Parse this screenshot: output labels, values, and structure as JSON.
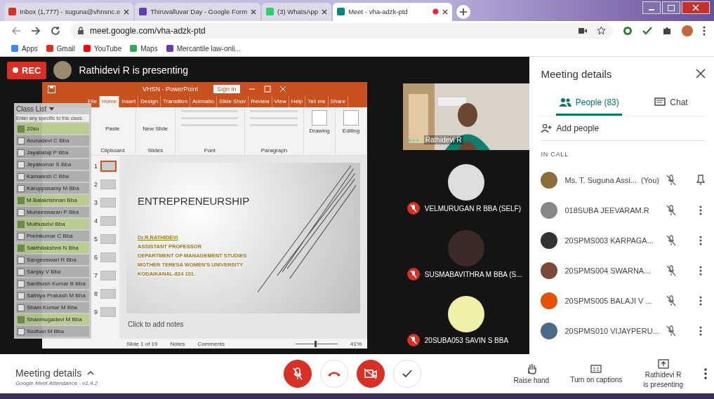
{
  "browser": {
    "tabs": [
      {
        "title": "Inbox (1,777) - suguna@vhnsnc.e",
        "kind": "mail",
        "selected": false
      },
      {
        "title": "Thiruvalluvar Day - Google Form",
        "kind": "form",
        "selected": false
      },
      {
        "title": "(3) WhatsApp",
        "kind": "chat",
        "selected": false
      },
      {
        "title": "Meet - vha-adzk-ptd",
        "kind": "video",
        "selected": true,
        "recording": true
      }
    ],
    "url": "meet.google.com/vha-adzk-ptd",
    "bookmarks": [
      {
        "label": "Apps",
        "kind": "grid"
      },
      {
        "label": "Gmail",
        "kind": "mail"
      },
      {
        "label": "YouTube",
        "kind": "play"
      },
      {
        "label": "Maps",
        "kind": "pin"
      },
      {
        "label": "Mercantile law-onli...",
        "kind": "form"
      }
    ]
  },
  "stage": {
    "rec": "REC",
    "banner": "Rathidevi R is presenting"
  },
  "powerpoint": {
    "title": "VHSN - PowerPoint",
    "sign_in": "Sign in",
    "tabs": [
      {
        "label": "File",
        "selected": false
      },
      {
        "label": "Home",
        "selected": true
      },
      {
        "label": "Insert",
        "selected": false
      },
      {
        "label": "Design",
        "selected": false
      },
      {
        "label": "Transition",
        "selected": false
      },
      {
        "label": "Animatio",
        "selected": false
      },
      {
        "label": "Slide Shov",
        "selected": false
      },
      {
        "label": "Review",
        "selected": false
      },
      {
        "label": "View",
        "selected": false
      },
      {
        "label": "Help",
        "selected": false
      }
    ],
    "tell_me": "Tell me",
    "share": "Share",
    "paste": "Paste",
    "new_slide": "New Slide",
    "drawing": "Drawing",
    "editing": "Editing",
    "groups": [
      "Clipboard",
      "Slides",
      "Font",
      "Paragraph"
    ],
    "thumbnails": [
      {
        "number": "1",
        "selected": true
      },
      {
        "number": "2",
        "selected": false
      },
      {
        "number": "3",
        "selected": false
      },
      {
        "number": "4",
        "selected": false
      },
      {
        "number": "5",
        "selected": false
      },
      {
        "number": "6",
        "selected": false
      },
      {
        "number": "7",
        "selected": false
      },
      {
        "number": "8",
        "selected": false
      },
      {
        "number": "9",
        "selected": false
      }
    ],
    "slide_title": "ENTREPRENEURSHIP",
    "slide_lines": [
      "Dr.R.RATHIDEVI",
      "ASSISTANT PROFESSOR",
      "DEPARTMENT OF MANAGEMENT STUDIES",
      "MOTHER TERESA WOMEN'S UNIVERSITY",
      "KODAIKANAL-624 101."
    ],
    "notes": "Click to add notes",
    "status": "Slide 1 of 19",
    "notes_button": "Notes",
    "comments_button": "Comments",
    "zoom": "41%",
    "zoom_slider": {
      "level": 0.45
    }
  },
  "attendance": {
    "title": "Class List",
    "placeholder": "Enter any specific to this class.",
    "footer": "Google Meet Attendance - v1.4.2",
    "students": [
      {
        "name": "20su",
        "checked": true
      },
      {
        "name": "Arunadevi C Bba",
        "checked": false
      },
      {
        "name": "Jayabalaji P Bba",
        "checked": false
      },
      {
        "name": "Jeyakumar S Bba",
        "checked": false
      },
      {
        "name": "Kamalesh C Bba",
        "checked": false
      },
      {
        "name": "Karuppasamy M Bba",
        "checked": false
      },
      {
        "name": "M.Balakrishnan Bba",
        "checked": true
      },
      {
        "name": "Muneeswaran P Bba",
        "checked": false
      },
      {
        "name": "Muthuselvi Bba",
        "checked": true
      },
      {
        "name": "Premkumar C Bba",
        "checked": false
      },
      {
        "name": "Sakthilakshmi N Bba",
        "checked": true
      },
      {
        "name": "Sangeeswari R Bba",
        "checked": false
      },
      {
        "name": "Sanjay V Bba",
        "checked": false
      },
      {
        "name": "Santhosh Kumar B Bba",
        "checked": false
      },
      {
        "name": "Sathiya Prakash M Bba",
        "checked": false
      },
      {
        "name": "Sham Kumar M Bba",
        "checked": false
      },
      {
        "name": "Shanmugadevi M Bba",
        "checked": true
      },
      {
        "name": "Sudhan M Bba",
        "checked": false
      }
    ]
  },
  "tiles": [
    {
      "name": "Rathidevi R",
      "kind": "video"
    },
    {
      "name": "VELMURUGAN R BBA (SELF)",
      "kind": "avatar",
      "muted": true
    },
    {
      "name": "SUSMABAVITHRA M BBA (S...",
      "kind": "avatar",
      "muted": true
    },
    {
      "name": "20SUBA053 SAVIN S BBA",
      "kind": "avatar",
      "muted": true
    }
  ],
  "panel": {
    "title": "Meeting details",
    "tabs": [
      {
        "label": "People (83)",
        "kind": "people",
        "selected": true
      },
      {
        "label": "Chat",
        "kind": "chat",
        "selected": false
      }
    ],
    "add_people": "Add people",
    "section": "IN CALL",
    "people": [
      {
        "name": "Ms. T. Suguna Assi...",
        "you": "(You)",
        "kind": "self"
      },
      {
        "name": "018SUBA JEEVARAM.R",
        "kind": "other"
      },
      {
        "name": "20SPMS003 KARPAGA...",
        "kind": "other"
      },
      {
        "name": "20SPMS004 SWARNA...",
        "kind": "other"
      },
      {
        "name": "20SPMS005 BALAJI V ...",
        "kind": "other"
      },
      {
        "name": "20SPMS010 VIJAYPERU...",
        "kind": "other"
      }
    ]
  },
  "bottom": {
    "meeting_details": "Meeting details",
    "mic_off": true,
    "camera_off": true,
    "actions": [
      {
        "label": "Raise hand",
        "kind": "hand"
      },
      {
        "label": "Turn on captions",
        "kind": "captions"
      },
      {
        "label": "Rathidevi R",
        "sub": "is presenting",
        "kind": "present"
      }
    ]
  }
}
